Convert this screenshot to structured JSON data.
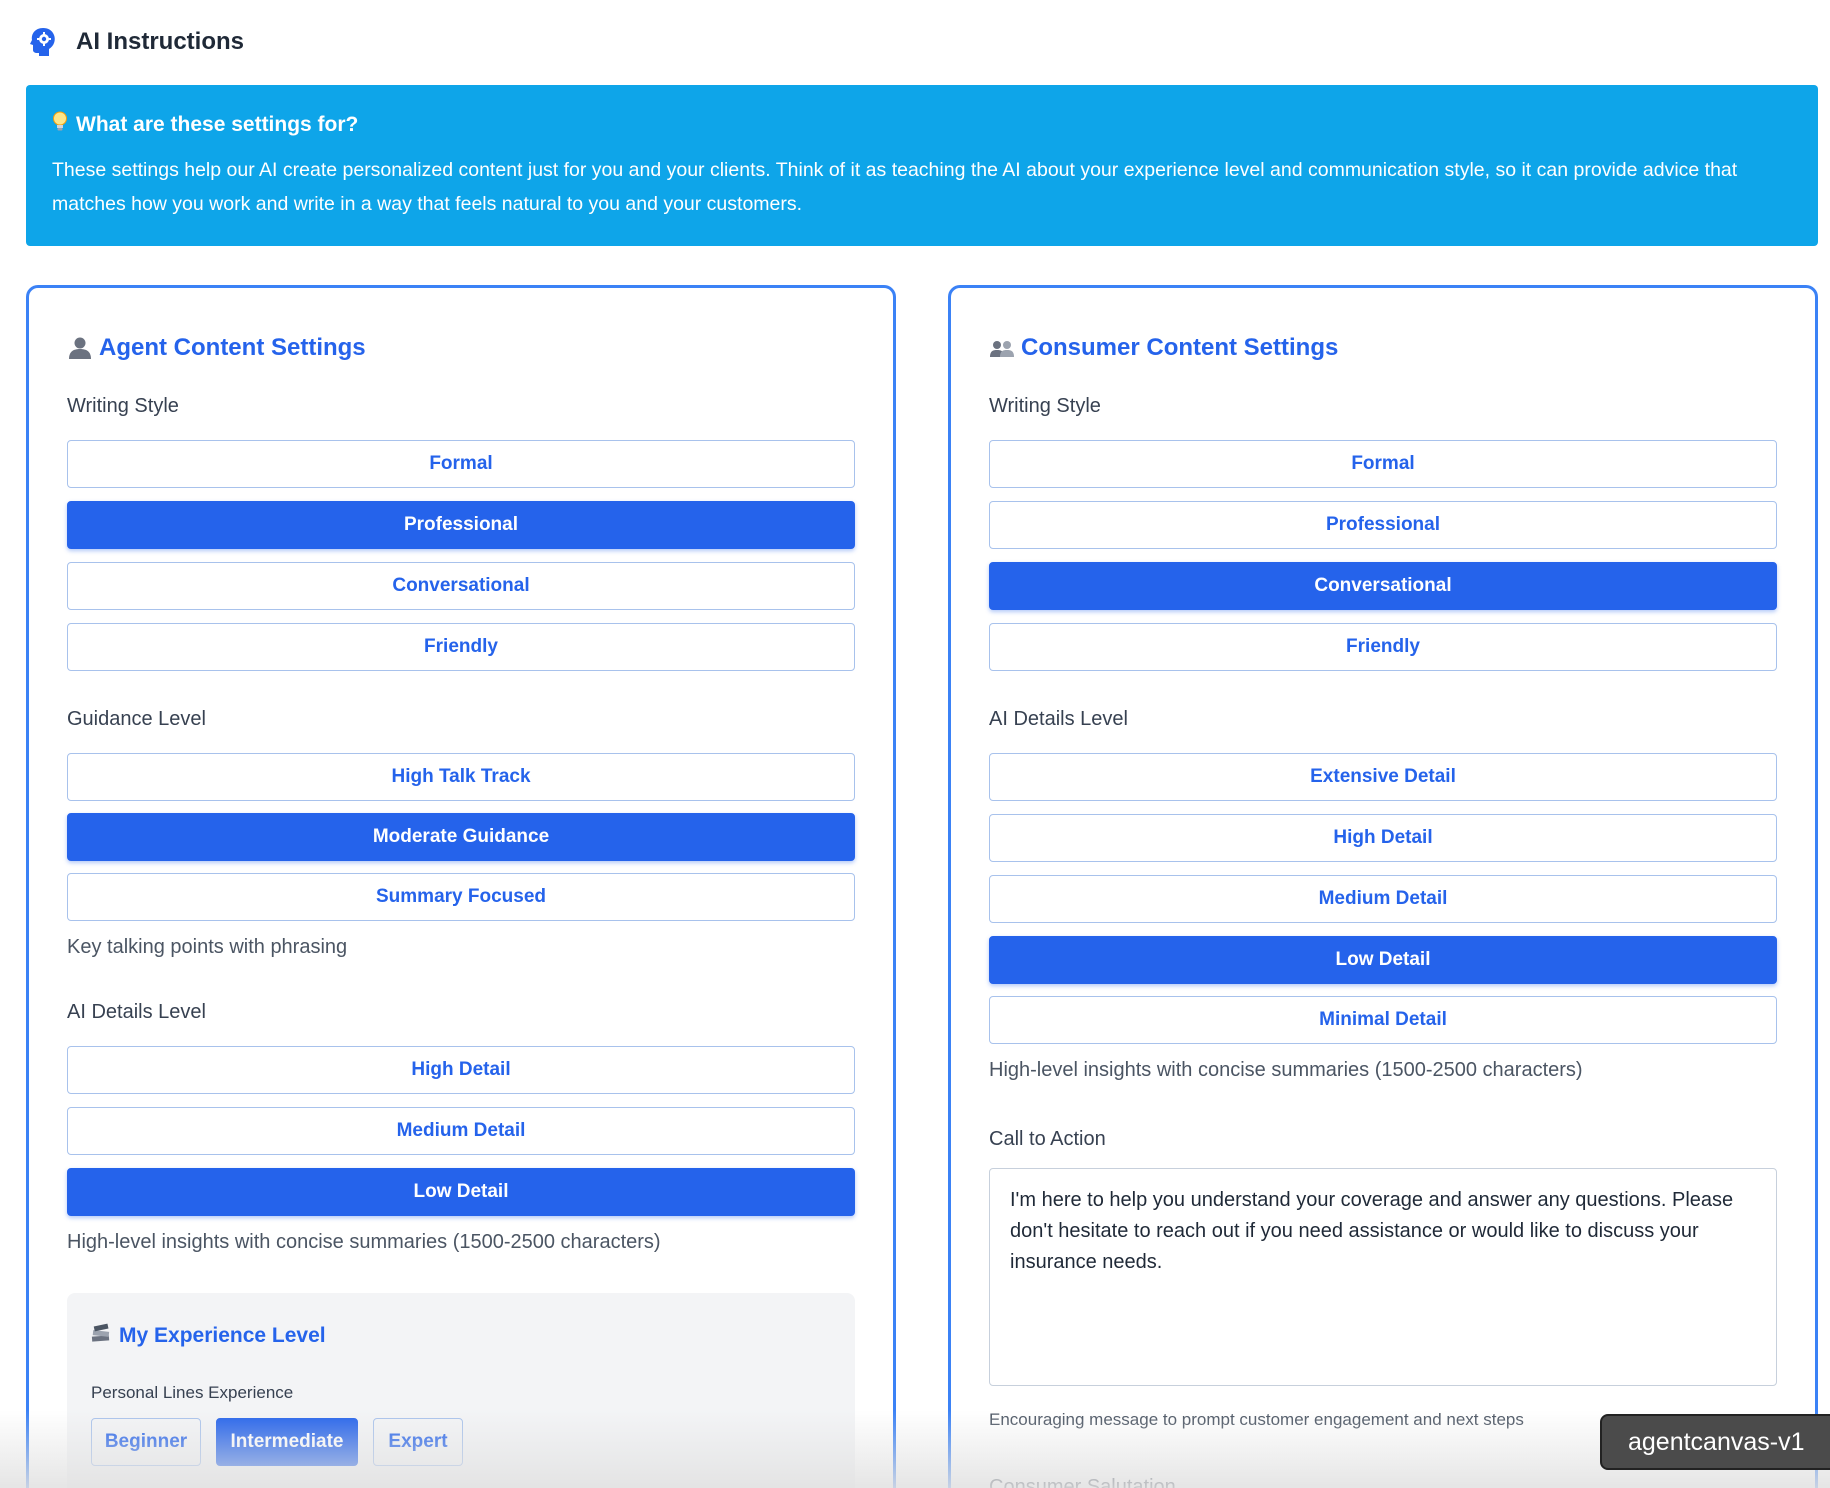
{
  "header": {
    "title": "AI Instructions",
    "icon": "ai-head-gear-icon"
  },
  "banner": {
    "title": "What are these settings for?",
    "icon": "lightbulb-icon",
    "text": "These settings help our AI create personalized content just for you and your clients. Think of it as teaching the AI about your experience level and communication style, so it can provide advice that matches how you work and write in a way that feels natural to you and your customers.",
    "color": "#0ea5e9"
  },
  "agent": {
    "title": "Agent Content Settings",
    "icon": "person-icon",
    "writing_style": {
      "label": "Writing Style",
      "options": [
        "Formal",
        "Professional",
        "Conversational",
        "Friendly"
      ],
      "selected": "Professional"
    },
    "guidance_level": {
      "label": "Guidance Level",
      "options": [
        "High Talk Track",
        "Moderate Guidance",
        "Summary Focused"
      ],
      "selected": "Moderate Guidance",
      "hint": "Key talking points with phrasing"
    },
    "details_level": {
      "label": "AI Details Level",
      "options": [
        "High Detail",
        "Medium Detail",
        "Low Detail"
      ],
      "selected": "Low Detail",
      "hint": "High-level insights with concise summaries (1500-2500 characters)"
    },
    "experience": {
      "title": "My Experience Level",
      "icon": "books-icon",
      "sublabel": "Personal Lines Experience",
      "options": [
        "Beginner",
        "Intermediate",
        "Expert"
      ],
      "selected": "Intermediate"
    }
  },
  "consumer": {
    "title": "Consumer Content Settings",
    "icon": "people-icon",
    "writing_style": {
      "label": "Writing Style",
      "options": [
        "Formal",
        "Professional",
        "Conversational",
        "Friendly"
      ],
      "selected": "Conversational"
    },
    "details_level": {
      "label": "AI Details Level",
      "options": [
        "Extensive Detail",
        "High Detail",
        "Medium Detail",
        "Low Detail",
        "Minimal Detail"
      ],
      "selected": "Low Detail",
      "hint": "High-level insights with concise summaries (1500-2500 characters)"
    },
    "call_to_action": {
      "label": "Call to Action",
      "value": "I'm here to help you understand your coverage and answer any questions. Please don't hesitate to reach out if you need assistance or would like to discuss your insurance needs.",
      "hint": "Encouraging message to prompt customer engagement and next steps"
    },
    "salutation_label": "Consumer Salutation"
  },
  "badge": {
    "text": "agentcanvas-v1"
  },
  "colors": {
    "accent": "#2563eb",
    "panel_border": "#3b82f6"
  }
}
